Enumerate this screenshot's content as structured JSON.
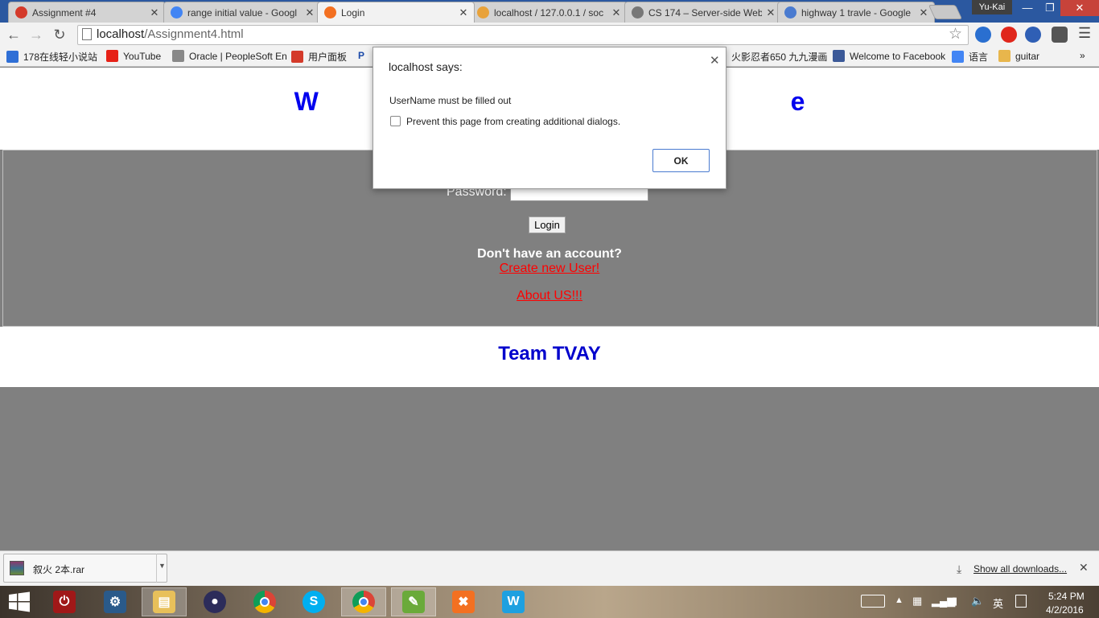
{
  "browser": {
    "tabs": [
      {
        "title": "Assignment #4",
        "icon": "circle-dotted-icon",
        "color": "#d43a2a"
      },
      {
        "title": "range initial value - Googl",
        "icon": "google-icon",
        "color": "#4285f4"
      },
      {
        "title": "Login",
        "icon": "xampp-icon",
        "color": "#f37021",
        "active": true
      },
      {
        "title": "localhost / 127.0.0.1 / soc",
        "icon": "phpmyadmin-icon",
        "color": "#e8a23a"
      },
      {
        "title": "CS 174 – Server-side Web",
        "icon": "page-icon",
        "color": "#777777"
      },
      {
        "title": "highway 1 travle - Google",
        "icon": "docs-icon",
        "color": "#4a7bd0"
      }
    ],
    "profile": "Yu-Kai",
    "url_host": "localhost",
    "url_path": "/Assignment4.html",
    "bookmarks": [
      {
        "label": "178在线轻小说站",
        "icon": "bookmark-site-icon",
        "color": "#2f6fd6"
      },
      {
        "label": "YouTube",
        "icon": "youtube-icon",
        "color": "#e62117"
      },
      {
        "label": "Oracle | PeopleSoft En",
        "icon": "page-icon",
        "color": "#888888"
      },
      {
        "label": "用户面板",
        "icon": "circle-dotted-icon",
        "color": "#d43a2a"
      },
      {
        "label": "P",
        "icon": "p-icon",
        "color": "#1c4aa8"
      },
      {
        "label": "火影忍者650 九九漫画",
        "icon": "page-icon",
        "color": "#888888"
      },
      {
        "label": "Welcome to Facebook",
        "icon": "facebook-icon",
        "color": "#3b5998"
      },
      {
        "label": "语言",
        "icon": "translate-icon",
        "color": "#4285f4"
      },
      {
        "label": "guitar",
        "icon": "folder-icon",
        "color": "#e8b64c"
      }
    ]
  },
  "page": {
    "welcome": "W                                                                  e",
    "password_label": "Password:",
    "login_button": "Login",
    "no_account": "Don't have an account?",
    "create_link": "Create new User!",
    "about_link": "About US!!!",
    "team": "Team TVAY"
  },
  "dialog": {
    "title": "localhost says:",
    "message": "UserName must be filled out",
    "checkbox_label": "Prevent this page from creating additional dialogs.",
    "ok": "OK"
  },
  "downloads": {
    "file": "叙火 2本.rar",
    "show_all": "Show all downloads..."
  },
  "taskbar": {
    "apps": [
      "power-icon",
      "control-panel-icon",
      "file-explorer-icon",
      "eclipse-icon",
      "chrome-icon",
      "skype-icon",
      "chrome-icon",
      "notepad-icon",
      "xampp-icon",
      "w-app-icon"
    ],
    "ime": "英",
    "time": "5:24 PM",
    "date": "4/2/2016"
  }
}
